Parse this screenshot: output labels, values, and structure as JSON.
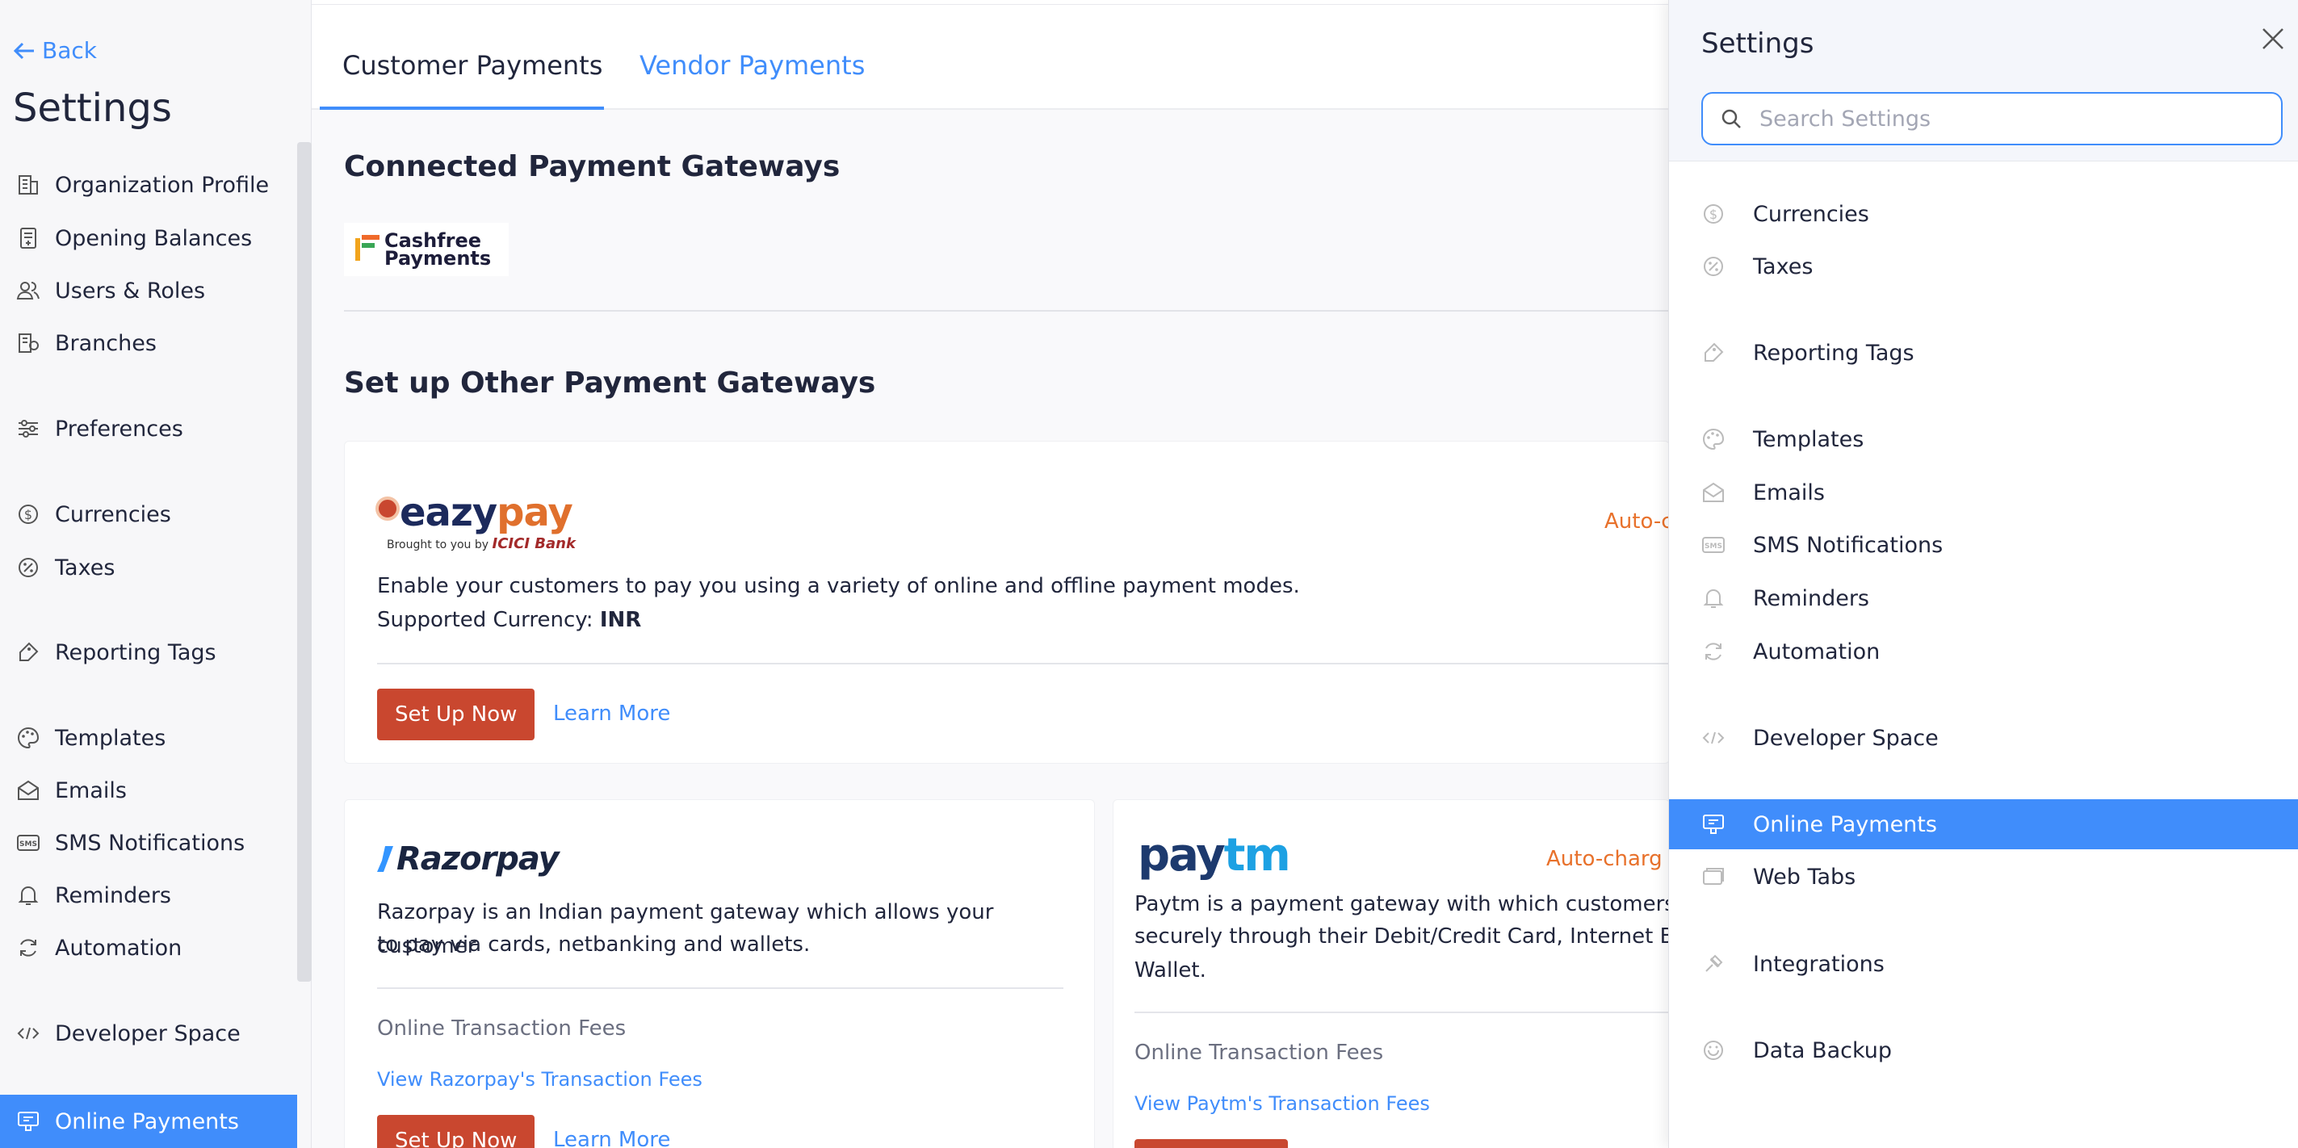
{
  "left_sidebar": {
    "back_label": "Back",
    "title": "Settings",
    "items": [
      {
        "label": "Organization Profile",
        "icon": "building-icon"
      },
      {
        "label": "Opening Balances",
        "icon": "ledger-icon"
      },
      {
        "label": "Users & Roles",
        "icon": "users-icon"
      },
      {
        "label": "Branches",
        "icon": "branch-icon"
      },
      {
        "label": "Preferences",
        "icon": "sliders-icon"
      },
      {
        "label": "Currencies",
        "icon": "currency-icon"
      },
      {
        "label": "Taxes",
        "icon": "percent-icon"
      },
      {
        "label": "Reporting Tags",
        "icon": "tag-icon"
      },
      {
        "label": "Templates",
        "icon": "palette-icon"
      },
      {
        "label": "Emails",
        "icon": "mail-icon"
      },
      {
        "label": "SMS Notifications",
        "icon": "sms-icon"
      },
      {
        "label": "Reminders",
        "icon": "bell-icon"
      },
      {
        "label": "Automation",
        "icon": "refresh-icon"
      },
      {
        "label": "Developer Space",
        "icon": "code-icon"
      },
      {
        "label": "Online Payments",
        "icon": "payment-icon"
      }
    ],
    "active_item": "Online Payments"
  },
  "tabs": {
    "customer": "Customer Payments",
    "vendor": "Vendor Payments"
  },
  "connected": {
    "title": "Connected Payment Gateways",
    "cashfree_logo_line1": "Cashfree",
    "cashfree_logo_line2": "Payments"
  },
  "setup": {
    "title": "Set up Other Payment Gateways"
  },
  "eazypay": {
    "logo_a": "eazy",
    "logo_b": "pay",
    "logo_sub": "Brought to you by",
    "logo_bank": "ICICI Bank",
    "autocharge": "Auto-charg",
    "description": "Enable your customers to pay you using a variety of online and offline payment modes.",
    "currency_label": "Supported Currency: ",
    "currency_value": "INR",
    "setup_label": "Set Up Now",
    "learn_label": "Learn More"
  },
  "razorpay": {
    "logo": "Razorpay",
    "desc_line1": "Razorpay is an Indian payment gateway which allows your customer",
    "desc_line2": "to pay via cards, netbanking and wallets.",
    "fees_label": "Online Transaction Fees",
    "fees_link": "View Razorpay's Transaction Fees",
    "setup_label": "Set Up Now",
    "learn_label": "Learn More"
  },
  "paytm": {
    "logo_a": "pay",
    "logo_b": "tm",
    "autocharge": "Auto-charg",
    "desc_line1": "Paytm is a payment gateway with which customers c",
    "desc_line2": "securely through their Debit/Credit Card, Internet Ba",
    "desc_line3": "Wallet.",
    "fees_label": "Online Transaction Fees",
    "fees_link": "View Paytm's Transaction Fees"
  },
  "overlay": {
    "title": "Settings",
    "search_placeholder": "Search Settings",
    "items": [
      {
        "label": "Currencies",
        "icon": "currency-icon"
      },
      {
        "label": "Taxes",
        "icon": "percent-icon"
      },
      {
        "label": "Reporting Tags",
        "icon": "tag-icon"
      },
      {
        "label": "Templates",
        "icon": "palette-icon"
      },
      {
        "label": "Emails",
        "icon": "mail-icon"
      },
      {
        "label": "SMS Notifications",
        "icon": "sms-icon"
      },
      {
        "label": "Reminders",
        "icon": "bell-icon"
      },
      {
        "label": "Automation",
        "icon": "refresh-icon"
      },
      {
        "label": "Developer Space",
        "icon": "code-icon"
      },
      {
        "label": "Online Payments",
        "icon": "payment-icon"
      },
      {
        "label": "Web Tabs",
        "icon": "tabs-icon"
      },
      {
        "label": "Integrations",
        "icon": "puzzle-icon"
      },
      {
        "label": "Data Backup",
        "icon": "backup-icon"
      }
    ],
    "active_item": "Online Payments"
  },
  "colors": {
    "accent": "#408dfb",
    "setup_button": "#c9472f",
    "autocharge": "#e8712b",
    "text": "#21263c"
  }
}
